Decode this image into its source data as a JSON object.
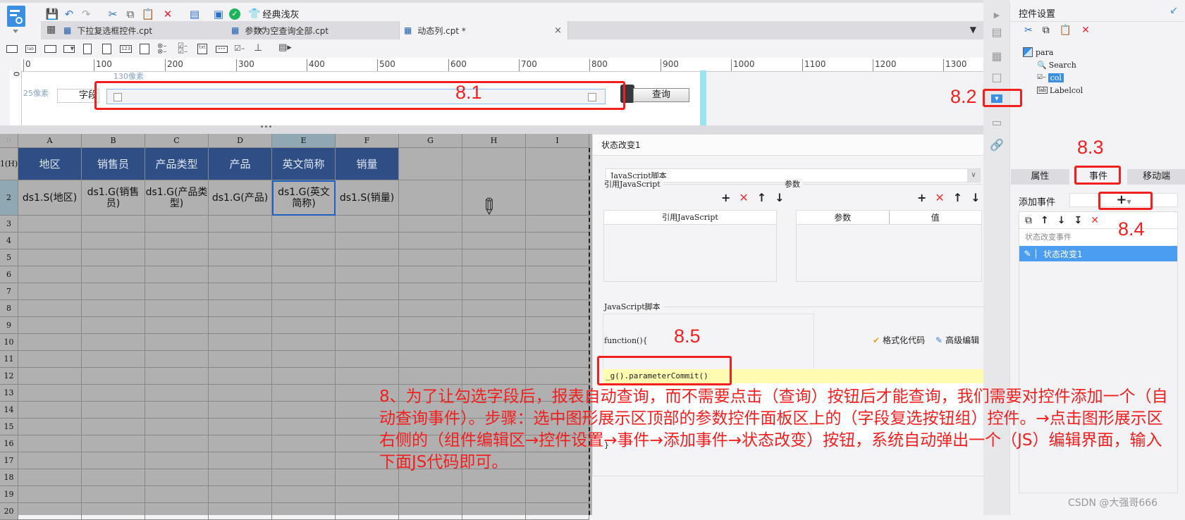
{
  "toolbar": {
    "theme_label": "经典浅灰",
    "icons": [
      "save-icon",
      "undo-icon",
      "redo-icon",
      "cut-icon",
      "copy-icon",
      "paste-icon",
      "delete-icon",
      "template-preview-icon",
      "preview-icon",
      "check-icon",
      "theme-icon"
    ]
  },
  "tabs": [
    {
      "label": "下拉复选框控件.cpt",
      "active": false
    },
    {
      "label": "参数为空查询全部.cpt",
      "active": false
    },
    {
      "label": "动态列.cpt *",
      "active": true
    }
  ],
  "widget_bar": {
    "items": [
      "text-box",
      "label",
      "button",
      "dropdown",
      "date",
      "calendar",
      "number",
      "textarea",
      "radio-group",
      "checkbox-group",
      "text",
      "password",
      "checkbox",
      "tree",
      "more"
    ]
  },
  "ruler": {
    "ticks": [
      "0",
      "100",
      "200",
      "300",
      "400",
      "500",
      "600",
      "700",
      "800",
      "900",
      "1000",
      "1100",
      "1200",
      "1300"
    ],
    "vertical_zero": "0"
  },
  "param_canvas": {
    "width_hint": "130像素",
    "height_hint": "25像素",
    "field_label": "字段",
    "query_button": "查询"
  },
  "grid": {
    "columns": [
      "A",
      "B",
      "C",
      "D",
      "E",
      "F",
      "G",
      "H",
      "I"
    ],
    "rows": [
      "1(H)",
      "2",
      "3",
      "4",
      "5",
      "6",
      "7",
      "8",
      "9",
      "10",
      "11",
      "12",
      "13",
      "14",
      "15",
      "16",
      "17",
      "18",
      "19",
      "20"
    ],
    "header_row": [
      "地区",
      "销售员",
      "产品类型",
      "产品",
      "英文简称",
      "销量"
    ],
    "data_row": [
      "ds1.S(地区)",
      "ds1.G(销售员)",
      "ds1.G(产品类型)",
      "ds1.G(产品)",
      "ds1.G(英文简称)",
      "ds1.S(销量)"
    ],
    "selected_cell": "E2"
  },
  "dialog": {
    "title": "状态改变1",
    "type_select": "JavaScript脚本",
    "ref_js_group": "引用JavaScript",
    "ref_js_column": "引用JavaScript",
    "params_group": "参数",
    "params_columns": [
      "参数",
      "值"
    ],
    "script_group": "JavaScript脚本",
    "function_header": "function(){",
    "code_line": "_g().parameterCommit()",
    "function_footer": "}",
    "format_code": "格式化代码",
    "advanced_edit": "高级编辑"
  },
  "right_panel": {
    "title": "控件设置",
    "tree": {
      "root": "para",
      "children": [
        {
          "label": "Search",
          "selected": false
        },
        {
          "label": "col",
          "selected": true
        },
        {
          "label": "Labelcol",
          "selected": false
        }
      ]
    },
    "tabs": [
      "属性",
      "事件",
      "移动端"
    ],
    "active_tab": "事件",
    "add_event_label": "添加事件",
    "event_group": "状态改变事件",
    "events": [
      "状态改变1"
    ]
  },
  "annotations": {
    "labels": [
      "8.1",
      "8.2",
      "8.3",
      "8.4",
      "8.5"
    ],
    "note": "8、为了让勾选字段后，报表自动查询，而不需要点击（查询）按钮后才能查询，我们需要对控件添加一个（自动查询事件）。步骤：选中图形展示区顶部的参数控件面板区上的（字段复选按钮组）控件。→点击图形展示区右侧的（组件编辑区→控件设置→事件→添加事件→状态改变）按钮，系统自动弹出一个（JS）编辑界面，输入下面JS代码即可。",
    "watermark": "CSDN @大强哥666"
  },
  "colors": {
    "header_blue": "#2f4e86",
    "selection_blue": "#4a9df0",
    "annotation_red": "#f21f1f",
    "code_highlight": "#fffbb0"
  }
}
